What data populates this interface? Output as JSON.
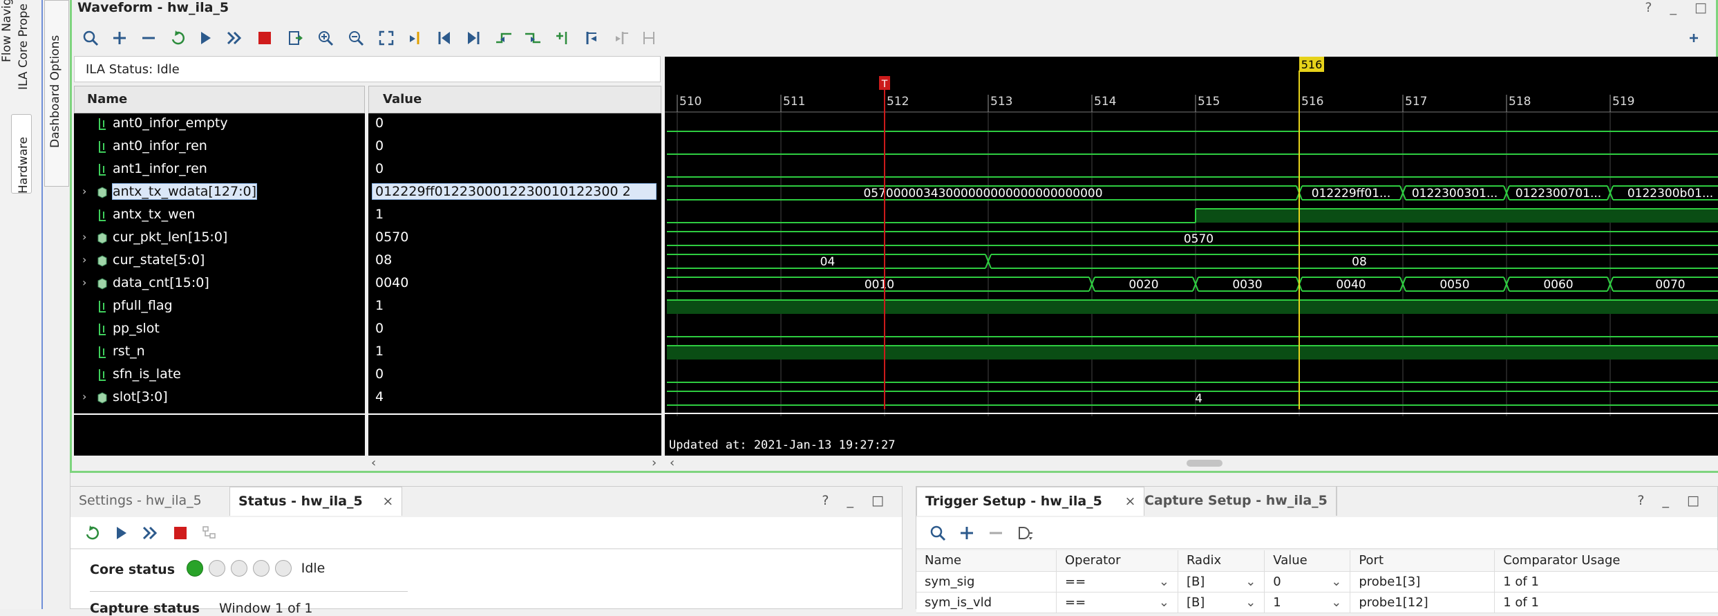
{
  "vertical_tabs": [
    "Flow Navig",
    "ILA Core Prope",
    "Dashboard Options",
    "Hardware"
  ],
  "waveform": {
    "title": "Waveform - hw_ila_5",
    "window_controls": "? _ □",
    "status": "ILA Status: Idle",
    "col_name": "Name",
    "col_value": "Value",
    "updated": "Updated at: 2021-Jan-13 19:27:27",
    "trigger_marker": "T",
    "cursor_label": "516",
    "time_ticks": [
      "510",
      "511",
      "512",
      "513",
      "514",
      "515",
      "516",
      "517",
      "518",
      "519"
    ],
    "signals": [
      {
        "name": "ant0_infor_empty",
        "value": "0",
        "expand": false,
        "icon": "bit-icon"
      },
      {
        "name": "ant0_infor_ren",
        "value": "0",
        "expand": false,
        "icon": "bit-icon"
      },
      {
        "name": "ant1_infor_ren",
        "value": "0",
        "expand": false,
        "icon": "bit-icon"
      },
      {
        "name": "antx_tx_wdata[127:0]",
        "value": "012229ff0122300012230010122300 2",
        "expand": true,
        "icon": "bus-icon",
        "selected": true
      },
      {
        "name": "antx_tx_wen",
        "value": "1",
        "expand": false,
        "icon": "bit-icon"
      },
      {
        "name": "cur_pkt_len[15:0]",
        "value": "0570",
        "expand": true,
        "icon": "bus-icon"
      },
      {
        "name": "cur_state[5:0]",
        "value": "08",
        "expand": true,
        "icon": "bus-icon"
      },
      {
        "name": "data_cnt[15:0]",
        "value": "0040",
        "expand": true,
        "icon": "bus-icon"
      },
      {
        "name": "pfull_flag",
        "value": "1",
        "expand": false,
        "icon": "bit-icon"
      },
      {
        "name": "pp_slot",
        "value": "0",
        "expand": false,
        "icon": "bit-icon"
      },
      {
        "name": "rst_n",
        "value": "1",
        "expand": false,
        "icon": "bit-icon"
      },
      {
        "name": "sfn_is_late",
        "value": "0",
        "expand": false,
        "icon": "bit-icon"
      },
      {
        "name": "slot[3:0]",
        "value": "4",
        "expand": true,
        "icon": "bus-icon"
      }
    ],
    "wave_labels": {
      "wdata_a": "05700000343000000000000000000000",
      "wdata_b": "012229ff01...",
      "wdata_c": "0122300301...",
      "wdata_d": "0122300701...",
      "wdata_e": "0122300b01...",
      "pkt_len": "0570",
      "state_a": "04",
      "state_b": "08",
      "cnt_0": "0010",
      "cnt_1": "0020",
      "cnt_2": "0030",
      "cnt_3": "0040",
      "cnt_4": "0050",
      "cnt_5": "0060",
      "cnt_6": "0070",
      "slot": "4"
    }
  },
  "settings_panel": {
    "tab_settings": "Settings - hw_ila_5",
    "tab_status": "Status - hw_ila_5",
    "close": "×",
    "controls": "? _ □",
    "core_status_label": "Core status",
    "core_status_value": "Idle",
    "capture_status_label": "Capture status",
    "capture_status_value": "Window 1 of 1"
  },
  "trigger_panel": {
    "tab_trigger": "Trigger Setup - hw_ila_5",
    "tab_capture": "Capture Setup - hw_ila_5",
    "close": "×",
    "controls": "? _ □",
    "columns": [
      "Name",
      "Operator",
      "Radix",
      "Value",
      "Port",
      "Comparator Usage"
    ],
    "rows": [
      [
        "sym_sig",
        "==",
        "[B]",
        "0",
        "probe1[3]",
        "1 of 1"
      ],
      [
        "sym_is_vld",
        "==",
        "[B]",
        "1",
        "probe1[12]",
        "1 of 1"
      ]
    ]
  },
  "colors": {
    "wave_green": "#2ecc40",
    "accent_green": "#7ed47e",
    "cursor_yellow": "#e6d21a",
    "trigger_red": "#cc1b1b"
  }
}
